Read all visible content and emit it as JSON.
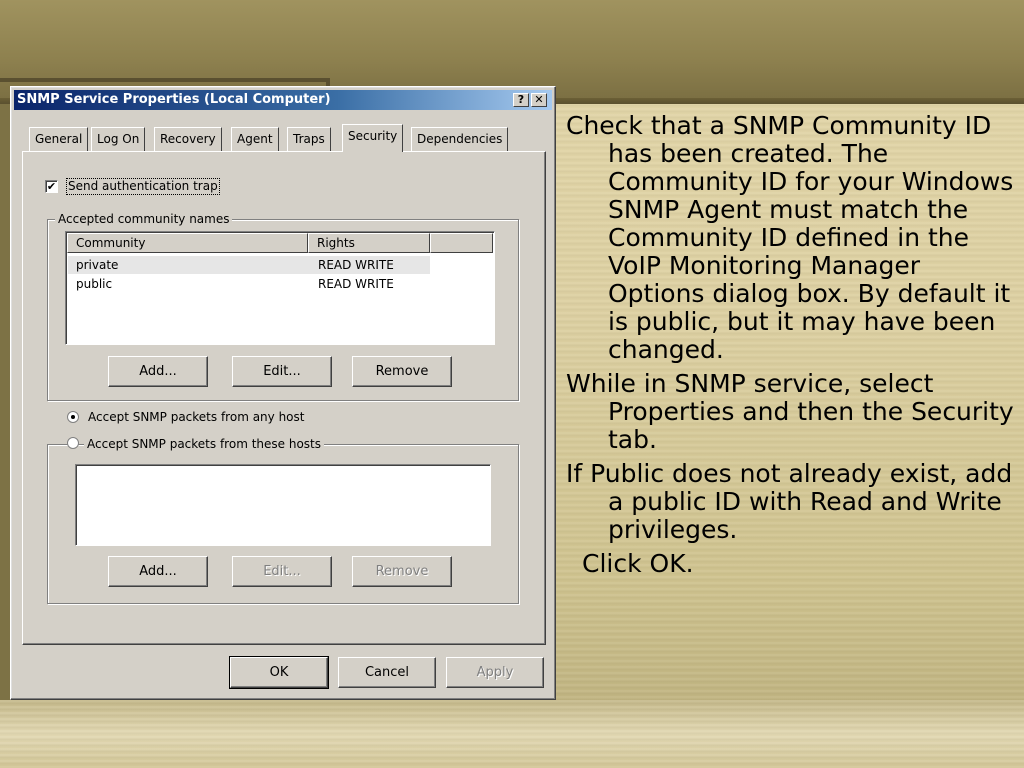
{
  "dialog": {
    "title": "SNMP Service Properties (Local Computer)",
    "help_button": "?",
    "close_button": "✕",
    "tabs": [
      {
        "label": "General",
        "active": false
      },
      {
        "label": "Log On",
        "active": false
      },
      {
        "label": "Recovery",
        "active": false
      },
      {
        "label": "Agent",
        "active": false
      },
      {
        "label": "Traps",
        "active": false
      },
      {
        "label": "Security",
        "active": true
      },
      {
        "label": "Dependencies",
        "active": false
      }
    ],
    "send_auth_trap": {
      "label": "Send authentication trap",
      "checked": true
    },
    "community_group": {
      "label": "Accepted community names",
      "columns": [
        "Community",
        "Rights"
      ],
      "rows": [
        {
          "community": "private",
          "rights": "READ WRITE",
          "selected": true
        },
        {
          "community": "public",
          "rights": "READ WRITE",
          "selected": false
        }
      ],
      "buttons": {
        "add": "Add...",
        "edit": "Edit...",
        "remove": "Remove"
      }
    },
    "accept_any": {
      "label": "Accept SNMP packets from any host",
      "selected": true
    },
    "accept_these": {
      "label": "Accept SNMP packets from these hosts",
      "selected": false
    },
    "hosts_buttons": {
      "add": "Add...",
      "edit": "Edit...",
      "remove": "Remove"
    },
    "footer": {
      "ok": "OK",
      "cancel": "Cancel",
      "apply": "Apply"
    }
  },
  "slide": {
    "bullets": [
      "Check that a SNMP Community ID has been created.   The Community ID for your Windows SNMP Agent must match the Community ID defined in the VoIP Monitoring Manager Options dialog box. By default it is public, but it may have been changed.",
      "While in SNMP service, select Properties and then the Security tab.",
      "If Public does not already exist, add a public ID with Read and Write privileges.",
      "Click OK."
    ]
  }
}
